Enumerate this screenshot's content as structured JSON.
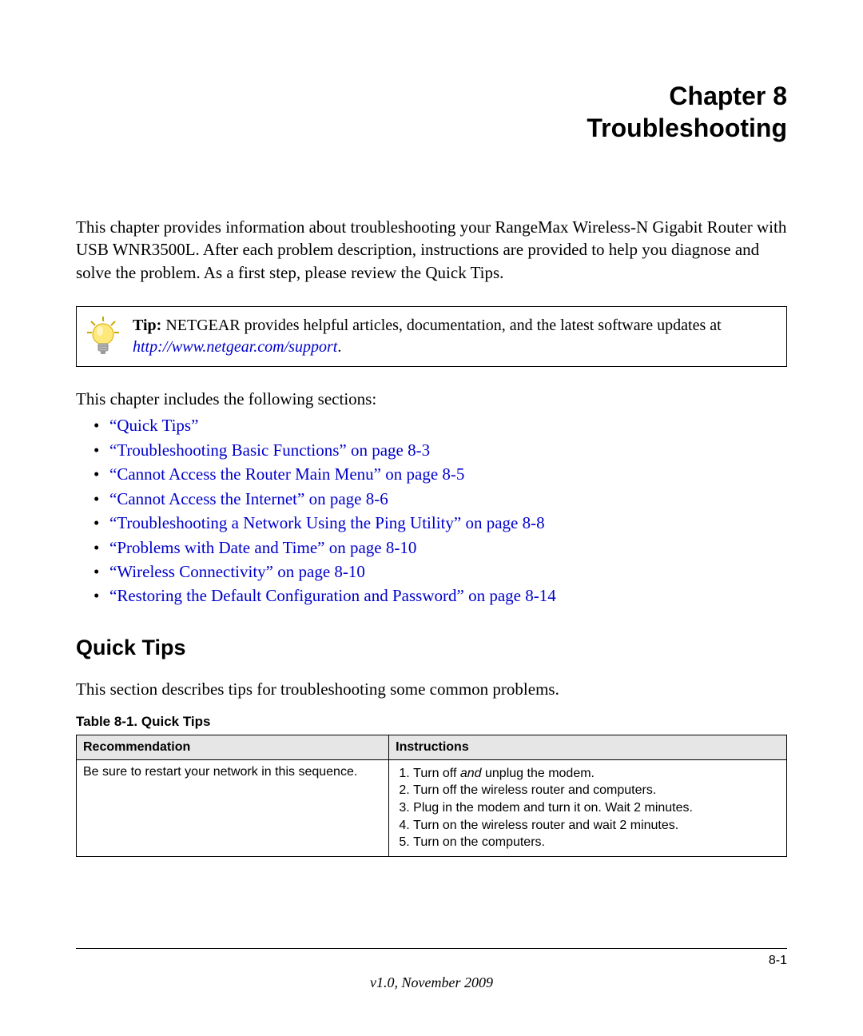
{
  "heading": {
    "line1": "Chapter 8",
    "line2": "Troubleshooting"
  },
  "intro_text": "This chapter provides information about troubleshooting your RangeMax Wireless-N Gigabit Router with USB WNR3500L. After each problem description, instructions are provided to help you diagnose and solve the problem. As a first step, please review the Quick Tips.",
  "tip": {
    "label": "Tip:",
    "body_before_link": " NETGEAR provides helpful articles, documentation, and the latest software updates at ",
    "link_text": "http://www.netgear.com/support",
    "body_after_link": "."
  },
  "toc_intro": "This chapter includes the following sections:",
  "toc": [
    "“Quick Tips”",
    "“Troubleshooting Basic Functions” on page 8-3",
    "“Cannot Access the Router Main Menu” on page 8-5",
    "“Cannot Access the Internet” on page 8-6",
    "“Troubleshooting a Network Using the Ping Utility” on page 8-8",
    "“Problems with Date and Time” on page 8-10",
    "“Wireless Connectivity” on page 8-10",
    "“Restoring the Default Configuration and Password” on page 8-14"
  ],
  "section": {
    "heading": "Quick Tips",
    "intro": "This section describes tips for troubleshooting some common problems."
  },
  "table": {
    "caption": "Table 8-1.  Quick Tips",
    "headers": {
      "col1": "Recommendation",
      "col2": "Instructions"
    },
    "row1": {
      "recommendation": "Be sure to restart your network in this sequence.",
      "steps": {
        "s1_pre": "Turn off ",
        "s1_em": "and",
        "s1_post": " unplug the modem.",
        "s2": "Turn off the wireless router and computers.",
        "s3": "Plug in the modem and turn it on. Wait 2 minutes.",
        "s4": "Turn on the wireless router and wait 2 minutes.",
        "s5": "Turn on the computers."
      }
    }
  },
  "footer": {
    "page_num": "8-1",
    "version": "v1.0, November 2009"
  },
  "colors": {
    "link": "#0000cc",
    "table_header_bg": "#e6e6e6"
  }
}
